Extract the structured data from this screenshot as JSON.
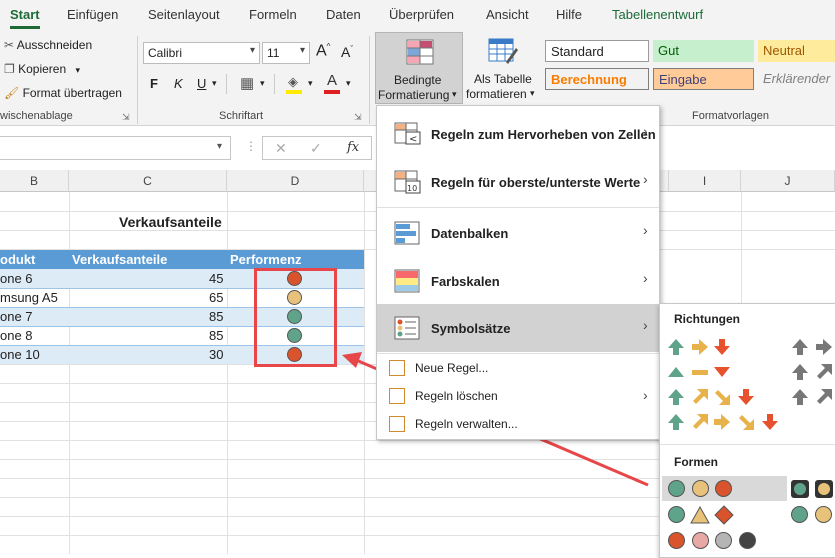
{
  "tabs": [
    "Start",
    "Einfügen",
    "Seitenlayout",
    "Formeln",
    "Daten",
    "Überprüfen",
    "Ansicht",
    "Hilfe",
    "Tabellenentwurf"
  ],
  "clipboard": {
    "cut": "Ausschneiden",
    "copy": "Kopieren",
    "format_painter": "Format übertragen",
    "group_label": "wischenablage"
  },
  "font": {
    "name": "Calibri",
    "size": "11",
    "bold": "F",
    "italic": "K",
    "underline": "U",
    "group_label": "Schriftart"
  },
  "cond_format": {
    "line1": "Bedingte",
    "line2": "Formatierung"
  },
  "as_table": {
    "line1": "Als Tabelle",
    "line2": "formatieren"
  },
  "styles": {
    "standard": "Standard",
    "gut": "Gut",
    "neutral": "Neutral",
    "berechnung": "Berechnung",
    "eingabe": "Eingabe",
    "erklaerend": "Erklärender",
    "group_label": "Formatvorlagen"
  },
  "formula_bar": {
    "fx": "fx"
  },
  "columns": [
    "B",
    "C",
    "D",
    "I",
    "J"
  ],
  "sheet": {
    "title": "Verkaufsanteile",
    "headers": [
      "odukt",
      "Verkaufsanteile",
      "Performenz"
    ],
    "rows": [
      {
        "product": "one 6",
        "value": "45",
        "status": "red"
      },
      {
        "product": "msung A5",
        "value": "65",
        "status": "yellow"
      },
      {
        "product": "one 7",
        "value": "85",
        "status": "green"
      },
      {
        "product": "one 8",
        "value": "85",
        "status": "green"
      },
      {
        "product": "one 10",
        "value": "30",
        "status": "red"
      }
    ]
  },
  "menu": {
    "items": [
      {
        "label": "Regeln zum Hervorheben von Zellen"
      },
      {
        "label": "Regeln für oberste/unterste Werte"
      },
      {
        "label": "Datenbalken"
      },
      {
        "label": "Farbskalen"
      },
      {
        "label": "Symbolsätze"
      }
    ],
    "small_items": [
      {
        "label": "Neue Regel..."
      },
      {
        "label": "Regeln löschen"
      },
      {
        "label": "Regeln verwalten..."
      }
    ]
  },
  "submenu": {
    "richtungen": "Richtungen",
    "formen": "Formen"
  },
  "colors": {
    "red": "#d9532c",
    "yellow": "#e8c27a",
    "green": "#5fa48a",
    "accent": "#1d6a37",
    "arrow_red": "#e7512d",
    "header_blue": "#5b9bd5",
    "row_blue": "#ddebf7",
    "annotation": "#e8474a"
  }
}
